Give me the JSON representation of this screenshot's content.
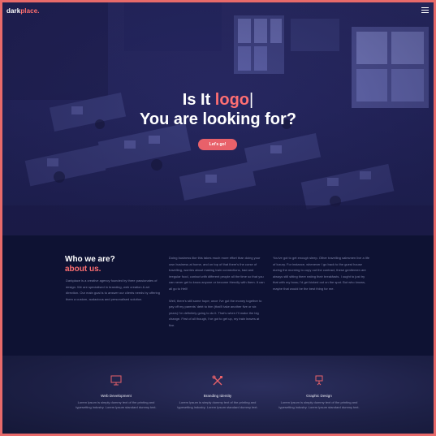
{
  "brand": {
    "part1": "dark",
    "part2": "place."
  },
  "icons": {
    "menu": "hamburger-icon",
    "service1": "monitor-icon",
    "service2": "tools-icon",
    "service3": "presentation-icon"
  },
  "colors": {
    "accent": "#ff6f72",
    "button": "#e8616a",
    "dark": "#0e1233"
  },
  "hero": {
    "line1_prefix": "Is It ",
    "line1_accent": "logo",
    "line1_caret": "|",
    "line2": "You are looking for?",
    "cta_label": "Let's go!"
  },
  "about": {
    "title_line1": "Who we are?",
    "title_line2": "about us.",
    "col1": "Darkplace is a creative agency founded by three passionates of design. We are specialised in branding, web creation & art direction. Our main goal is to answer our clients needs by offering them a custom, audacious and personalised solution.",
    "col2_p1": "Doing business like this takes much more effort than doing your own business at home, and on top of that there's the curse of travelling, worries about making train connections, bad and irregular food, contact with different people all the time so that you can never get to know anyone or become friendly with them. It can all go to Hell!",
    "col2_p2": "Well, there's still some hope; once I've got the money together to pay off my parents' debt to him (that'll take another five or six years) I'm definitely going to do it. That's when I'll make the big change. First of all though, I've got to get up, my train leaves at five.",
    "col3": "You've got to get enough sleep. Other travelling salesmen live a life of luxury. For instance, whenever I go back to the guest house during the morning to copy out the contract, these gentlemen are always still sitting there eating their breakfasts. I ought to just try that with my boss; I'd get kicked out on the spot. But who knows, maybe that would be the best thing for me."
  },
  "services": [
    {
      "title": "Web Development",
      "desc": "Lorem Ipsum is simply dummy text of the printing and typesetting industry. Lorem Ipsum standard dummy text."
    },
    {
      "title": "Branding Identity",
      "desc": "Lorem Ipsum is simply dummy text of the printing and typesetting industry. Lorem Ipsum standard dummy text."
    },
    {
      "title": "Graphic Design",
      "desc": "Lorem Ipsum is simply dummy text of the printing and typesetting industry. Lorem Ipsum standard dummy text."
    }
  ]
}
